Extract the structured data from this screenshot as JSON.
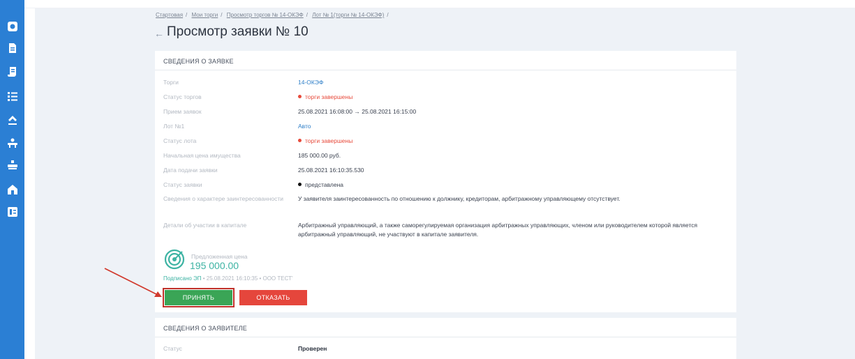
{
  "sidebar": {
    "items": [
      {
        "icon": "logo-icon"
      },
      {
        "icon": "document-icon"
      },
      {
        "icon": "scroll-icon"
      },
      {
        "icon": "list-icon"
      },
      {
        "icon": "gavel-icon"
      },
      {
        "icon": "bench-icon"
      },
      {
        "icon": "bench-alt-icon"
      },
      {
        "icon": "home-icon"
      },
      {
        "icon": "id-card-icon"
      }
    ],
    "color": "#2b7fd4"
  },
  "breadcrumb": {
    "items": [
      "Стартовая",
      "Мои торги",
      "Просмотр торгов № 14-ОКЭФ",
      "Лот № 1(торги № 14-ОКЭФ)"
    ]
  },
  "page": {
    "title": "Просмотр заявки № 10"
  },
  "application": {
    "header": "СВЕДЕНИЯ О ЗАЯВКЕ",
    "rows": [
      {
        "label": "Торги",
        "value": "14-ОКЭФ"
      },
      {
        "label": "Статус торгов",
        "value": "торги завершены"
      },
      {
        "label": "Прием заявок",
        "value": "25.08.2021 16:08:00 → 25.08.2021 16:15:00"
      },
      {
        "label": "Лот №1",
        "value": "Авто"
      },
      {
        "label": "Статус лота",
        "value": "торги завершены"
      },
      {
        "label": "Начальная цена имущества",
        "value": "185 000.00 руб."
      },
      {
        "label": "Дата подачи заявки",
        "value": "25.08.2021 16:10:35.530"
      },
      {
        "label": "Статус заявки",
        "value": "представлена"
      },
      {
        "label": "Сведения о характере заинтересованности",
        "value": "У заявителя заинтересованность по отношению к должнику, кредиторам, арбитражному управляющему отсутствует."
      },
      {
        "label": "Детали об участии в капитале",
        "value": "Арбитражный управляющий, а также саморегулируемая организация арбитражных управляющих, членом или руководителем которой является арбитражный управляющий, не участвуют в капитале заявителя."
      }
    ],
    "price_label": "Предложенная цена",
    "price_value": "195 000.00",
    "signed_text": "Подписано ЭП",
    "signed_meta": "25.08.2021 16:10:35",
    "signed_org": "ООО ТЕСТ'",
    "accept_label": "ПРИНЯТЬ",
    "reject_label": "ОТКАЗАТЬ"
  },
  "applicant": {
    "header": "СВЕДЕНИЯ О ЗАЯВИТЕЛЕ",
    "rows": [
      {
        "label": "Статус",
        "value": "Проверен"
      }
    ]
  },
  "colors": {
    "accent": "#2f7fc8",
    "status_red": "#e74a3b",
    "accept_green": "#3aa556",
    "reject_red": "#e5463c",
    "price_teal": "#3db3a3",
    "annotation_red": "#c0312a"
  }
}
